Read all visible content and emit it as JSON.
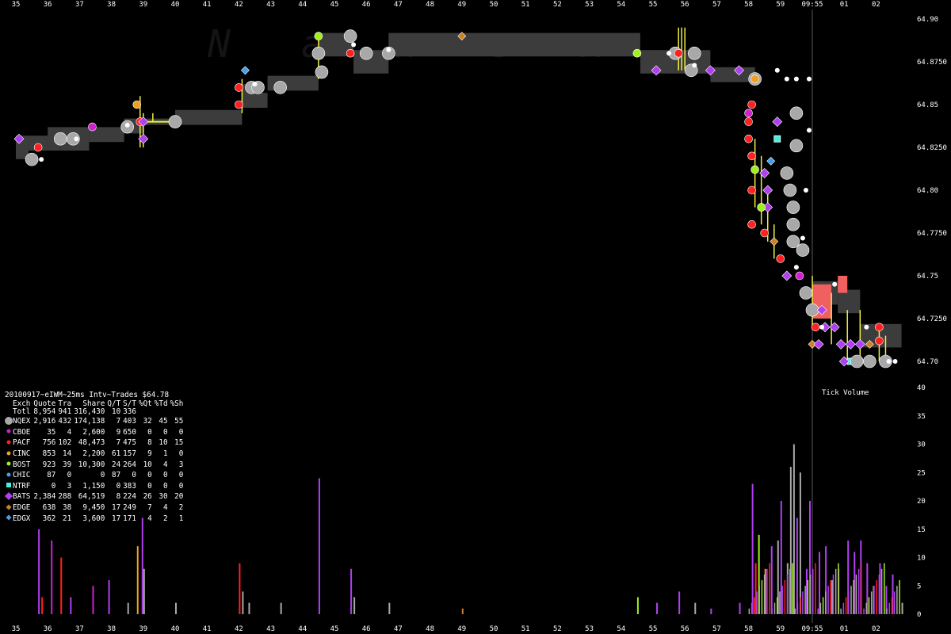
{
  "watermark": "Nanex",
  "legend": {
    "title": "20100917~eIWM~25ms Intv~Trades $64.78",
    "headers": [
      "Exch",
      "Quote",
      "Tra",
      "Share",
      "Q/T",
      "S/T",
      "%Qt",
      "%Td",
      "%Sh"
    ],
    "rows": [
      {
        "exch": "Totl",
        "quote": "8,954",
        "tra": "941",
        "share": "316,430",
        "qt": "10",
        "st": "336",
        "pq": "",
        "ptd": "",
        "psh": "",
        "color": "",
        "marker": "none"
      },
      {
        "exch": "NQEX",
        "quote": "2,916",
        "tra": "432",
        "share": "174,138",
        "qt": "7",
        "st": "403",
        "pq": "32",
        "ptd": "45",
        "psh": "55",
        "color": "#a8a8a8",
        "marker": "circle-large"
      },
      {
        "exch": "CBOE",
        "quote": "35",
        "tra": "4",
        "share": "2,600",
        "qt": "9",
        "st": "650",
        "pq": "0",
        "ptd": "0",
        "psh": "0",
        "color": "#d020d0",
        "marker": "circle"
      },
      {
        "exch": "PACF",
        "quote": "756",
        "tra": "102",
        "share": "48,473",
        "qt": "7",
        "st": "475",
        "pq": "8",
        "ptd": "10",
        "psh": "15",
        "color": "#ff2020",
        "marker": "circle"
      },
      {
        "exch": "CINC",
        "quote": "853",
        "tra": "14",
        "share": "2,200",
        "qt": "61",
        "st": "157",
        "pq": "9",
        "ptd": "1",
        "psh": "0",
        "color": "#f0a020",
        "marker": "circle"
      },
      {
        "exch": "BOST",
        "quote": "923",
        "tra": "39",
        "share": "10,300",
        "qt": "24",
        "st": "264",
        "pq": "10",
        "ptd": "4",
        "psh": "3",
        "color": "#a0f020",
        "marker": "circle"
      },
      {
        "exch": "CHIC",
        "quote": "87",
        "tra": "0",
        "share": "0",
        "qt": "87",
        "st": "0",
        "pq": "0",
        "ptd": "0",
        "psh": "0",
        "color": "#40a0f0",
        "marker": "circle"
      },
      {
        "exch": "NTRF",
        "quote": "0",
        "tra": "3",
        "share": "1,150",
        "qt": "0",
        "st": "383",
        "pq": "0",
        "ptd": "0",
        "psh": "0",
        "color": "#40f0e0",
        "marker": "square"
      },
      {
        "exch": "BATS",
        "quote": "2,384",
        "tra": "288",
        "share": "64,519",
        "qt": "8",
        "st": "224",
        "pq": "26",
        "ptd": "30",
        "psh": "20",
        "color": "#b040f0",
        "marker": "diamond-large"
      },
      {
        "exch": "EDGE",
        "quote": "638",
        "tra": "38",
        "share": "9,450",
        "qt": "17",
        "st": "249",
        "pq": "7",
        "ptd": "4",
        "psh": "2",
        "color": "#d08020",
        "marker": "diamond"
      },
      {
        "exch": "EDGX",
        "quote": "362",
        "tra": "21",
        "share": "3,600",
        "qt": "17",
        "st": "171",
        "pq": "4",
        "ptd": "2",
        "psh": "1",
        "color": "#40a0f0",
        "marker": "diamond"
      }
    ]
  },
  "chart_data": [
    {
      "type": "scatter",
      "title": "",
      "x_axis": {
        "ticks": [
          "35",
          "36",
          "37",
          "38",
          "39",
          "40",
          "41",
          "42",
          "43",
          "44",
          "45",
          "46",
          "47",
          "48",
          "49",
          "50",
          "51",
          "52",
          "53",
          "54",
          "55",
          "56",
          "57",
          "58",
          "59",
          "09:55",
          "01",
          "02"
        ],
        "highlight_label": "09:55"
      },
      "y_axis": {
        "side": "right",
        "ticks": [
          "64.90",
          "64.8750",
          "64.85",
          "64.8250",
          "64.80",
          "64.7750",
          "64.75",
          "64.7250",
          "64.70"
        ],
        "ylim": [
          64.7,
          64.9
        ]
      },
      "nbbo_bands": [
        {
          "x0": 35.0,
          "x1": 35.4,
          "bid": 64.82,
          "ask": 64.83
        },
        {
          "x0": 35.4,
          "x1": 36.0,
          "bid": 64.825,
          "ask": 64.83
        },
        {
          "x0": 36.0,
          "x1": 36.4,
          "bid": 64.825,
          "ask": 64.835
        },
        {
          "x0": 36.4,
          "x1": 37.3,
          "bid": 64.825,
          "ask": 64.835
        },
        {
          "x0": 37.3,
          "x1": 38.4,
          "bid": 64.83,
          "ask": 64.835
        },
        {
          "x0": 38.4,
          "x1": 39.0,
          "bid": 64.835,
          "ask": 64.84
        },
        {
          "x0": 39.0,
          "x1": 40.0,
          "bid": 64.84,
          "ask": 64.84
        },
        {
          "x0": 40.0,
          "x1": 42.1,
          "bid": 64.84,
          "ask": 64.845
        },
        {
          "x0": 42.1,
          "x1": 42.6,
          "bid": 64.85,
          "ask": 64.86
        },
        {
          "x0": 42.6,
          "x1": 42.9,
          "bid": 64.85,
          "ask": 64.855
        },
        {
          "x0": 42.9,
          "x1": 44.5,
          "bid": 64.86,
          "ask": 64.865
        },
        {
          "x0": 44.5,
          "x1": 45.6,
          "bid": 64.88,
          "ask": 64.89
        },
        {
          "x0": 45.6,
          "x1": 46.7,
          "bid": 64.87,
          "ask": 64.88
        },
        {
          "x0": 46.7,
          "x1": 54.6,
          "bid": 64.88,
          "ask": 64.89
        },
        {
          "x0": 54.6,
          "x1": 55.7,
          "bid": 64.87,
          "ask": 64.88
        },
        {
          "x0": 55.7,
          "x1": 56.8,
          "bid": 64.87,
          "ask": 64.88
        },
        {
          "x0": 56.8,
          "x1": 58.2,
          "bid": 64.865,
          "ask": 64.87
        },
        {
          "x0": 60.0,
          "x1": 60.4,
          "bid": 64.73,
          "ask": 64.745
        },
        {
          "x0": 60.4,
          "x1": 60.8,
          "bid": 64.735,
          "ask": 64.745
        },
        {
          "x0": 60.8,
          "x1": 61.5,
          "bid": 64.73,
          "ask": 64.74
        },
        {
          "x0": 61.5,
          "x1": 62.8,
          "bid": 64.71,
          "ask": 64.72
        }
      ],
      "trades": [
        {
          "t": 35.1,
          "p": 64.83,
          "exch": "BATS"
        },
        {
          "t": 35.7,
          "p": 64.825,
          "exch": "PACF"
        },
        {
          "t": 35.5,
          "p": 64.818,
          "exch": "NQEX"
        },
        {
          "t": 36.4,
          "p": 64.83,
          "exch": "NQEX"
        },
        {
          "t": 36.8,
          "p": 64.83,
          "exch": "NQEX"
        },
        {
          "t": 37.4,
          "p": 64.837,
          "exch": "CBOE"
        },
        {
          "t": 38.5,
          "p": 64.837,
          "exch": "NQEX"
        },
        {
          "t": 38.8,
          "p": 64.85,
          "exch": "CINC"
        },
        {
          "t": 38.9,
          "p": 64.84,
          "exch": "PACF"
        },
        {
          "t": 39.0,
          "p": 64.84,
          "exch": "BATS"
        },
        {
          "t": 39.0,
          "p": 64.83,
          "exch": "BATS"
        },
        {
          "t": 40.0,
          "p": 64.84,
          "exch": "NQEX"
        },
        {
          "t": 42.0,
          "p": 64.85,
          "exch": "PACF"
        },
        {
          "t": 42.0,
          "p": 64.86,
          "exch": "PACF"
        },
        {
          "t": 42.2,
          "p": 64.87,
          "exch": "EDGX"
        },
        {
          "t": 42.4,
          "p": 64.86,
          "exch": "NQEX"
        },
        {
          "t": 42.6,
          "p": 64.86,
          "exch": "NQEX"
        },
        {
          "t": 43.3,
          "p": 64.86,
          "exch": "NQEX"
        },
        {
          "t": 44.5,
          "p": 64.89,
          "exch": "BOST"
        },
        {
          "t": 44.5,
          "p": 64.88,
          "exch": "NQEX"
        },
        {
          "t": 44.6,
          "p": 64.869,
          "exch": "NQEX"
        },
        {
          "t": 45.5,
          "p": 64.89,
          "exch": "NQEX"
        },
        {
          "t": 45.5,
          "p": 64.88,
          "exch": "PACF"
        },
        {
          "t": 46.0,
          "p": 64.88,
          "exch": "NQEX"
        },
        {
          "t": 46.7,
          "p": 64.88,
          "exch": "NQEX"
        },
        {
          "t": 49.0,
          "p": 64.89,
          "exch": "EDGE"
        },
        {
          "t": 54.5,
          "p": 64.88,
          "exch": "BOST"
        },
        {
          "t": 55.1,
          "p": 64.87,
          "exch": "BATS"
        },
        {
          "t": 55.7,
          "p": 64.88,
          "exch": "NQEX"
        },
        {
          "t": 55.8,
          "p": 64.88,
          "exch": "PACF"
        },
        {
          "t": 56.2,
          "p": 64.87,
          "exch": "NQEX"
        },
        {
          "t": 56.3,
          "p": 64.88,
          "exch": "NQEX"
        },
        {
          "t": 56.8,
          "p": 64.87,
          "exch": "BATS"
        },
        {
          "t": 57.7,
          "p": 64.87,
          "exch": "BATS"
        },
        {
          "t": 58.2,
          "p": 64.865,
          "exch": "NQEX"
        },
        {
          "t": 58.2,
          "p": 64.865,
          "exch": "CINC"
        },
        {
          "t": 58.1,
          "p": 64.85,
          "exch": "PACF"
        },
        {
          "t": 58.0,
          "p": 64.845,
          "exch": "CBOE"
        },
        {
          "t": 58.0,
          "p": 64.84,
          "exch": "PACF"
        },
        {
          "t": 58.0,
          "p": 64.83,
          "exch": "PACF"
        },
        {
          "t": 58.1,
          "p": 64.82,
          "exch": "PACF"
        },
        {
          "t": 58.2,
          "p": 64.812,
          "exch": "BOST"
        },
        {
          "t": 58.5,
          "p": 64.81,
          "exch": "BATS"
        },
        {
          "t": 58.6,
          "p": 64.8,
          "exch": "BATS"
        },
        {
          "t": 58.1,
          "p": 64.8,
          "exch": "PACF"
        },
        {
          "t": 58.4,
          "p": 64.79,
          "exch": "BOST"
        },
        {
          "t": 58.6,
          "p": 64.79,
          "exch": "BATS"
        },
        {
          "t": 58.1,
          "p": 64.78,
          "exch": "PACF"
        },
        {
          "t": 58.5,
          "p": 64.775,
          "exch": "PACF"
        },
        {
          "t": 58.8,
          "p": 64.77,
          "exch": "EDGE"
        },
        {
          "t": 58.4,
          "p": 64.79,
          "exch": "BOST"
        },
        {
          "t": 58.9,
          "p": 64.84,
          "exch": "BATS"
        },
        {
          "t": 58.9,
          "p": 64.83,
          "exch": "NTRF"
        },
        {
          "t": 58.7,
          "p": 64.817,
          "exch": "EDGX"
        },
        {
          "t": 59.2,
          "p": 64.81,
          "exch": "NQEX"
        },
        {
          "t": 59.3,
          "p": 64.8,
          "exch": "NQEX"
        },
        {
          "t": 59.4,
          "p": 64.79,
          "exch": "NQEX"
        },
        {
          "t": 59.4,
          "p": 64.78,
          "exch": "NQEX"
        },
        {
          "t": 59.4,
          "p": 64.77,
          "exch": "NQEX"
        },
        {
          "t": 59.7,
          "p": 64.765,
          "exch": "NQEX"
        },
        {
          "t": 59.5,
          "p": 64.845,
          "exch": "NQEX"
        },
        {
          "t": 59.5,
          "p": 64.826,
          "exch": "NQEX"
        },
        {
          "t": 59.0,
          "p": 64.76,
          "exch": "PACF"
        },
        {
          "t": 59.2,
          "p": 64.75,
          "exch": "BATS"
        },
        {
          "t": 59.6,
          "p": 64.75,
          "exch": "CBOE"
        },
        {
          "t": 59.8,
          "p": 64.74,
          "exch": "NQEX"
        },
        {
          "t": 60.0,
          "p": 64.73,
          "exch": "NQEX"
        },
        {
          "t": 60.3,
          "p": 64.73,
          "exch": "BATS"
        },
        {
          "t": 60.1,
          "p": 64.72,
          "exch": "PACF"
        },
        {
          "t": 60.4,
          "p": 64.72,
          "exch": "BATS"
        },
        {
          "t": 60.7,
          "p": 64.72,
          "exch": "BATS"
        },
        {
          "t": 60.0,
          "p": 64.71,
          "exch": "EDGE"
        },
        {
          "t": 60.2,
          "p": 64.71,
          "exch": "BATS"
        },
        {
          "t": 60.9,
          "p": 64.71,
          "exch": "BATS"
        },
        {
          "t": 61.2,
          "p": 64.71,
          "exch": "BATS"
        },
        {
          "t": 61.5,
          "p": 64.71,
          "exch": "BATS"
        },
        {
          "t": 61.8,
          "p": 64.71,
          "exch": "EDGE"
        },
        {
          "t": 62.1,
          "p": 64.712,
          "exch": "PACF"
        },
        {
          "t": 61.2,
          "p": 64.7,
          "exch": "NTRF"
        },
        {
          "t": 61.0,
          "p": 64.7,
          "exch": "BATS"
        },
        {
          "t": 61.4,
          "p": 64.7,
          "exch": "NQEX"
        },
        {
          "t": 61.8,
          "p": 64.7,
          "exch": "NQEX"
        },
        {
          "t": 62.3,
          "p": 64.7,
          "exch": "NQEX"
        },
        {
          "t": 62.1,
          "p": 64.72,
          "exch": "PACF"
        }
      ]
    },
    {
      "type": "bar",
      "title": "Tick Volume",
      "y_axis": {
        "side": "right",
        "ticks": [
          "40",
          "35",
          "30",
          "25",
          "20",
          "15",
          "10",
          "5",
          "0"
        ],
        "ylim": [
          0,
          40
        ]
      },
      "bars": [
        {
          "t": 35.7,
          "v": 15,
          "exch": "BATS"
        },
        {
          "t": 35.8,
          "v": 3,
          "exch": "PACF"
        },
        {
          "t": 36.1,
          "v": 13,
          "exch": "CBOE"
        },
        {
          "t": 36.4,
          "v": 10,
          "exch": "PACF"
        },
        {
          "t": 36.7,
          "v": 3,
          "exch": "BATS"
        },
        {
          "t": 37.4,
          "v": 5,
          "exch": "CBOE"
        },
        {
          "t": 37.9,
          "v": 6,
          "exch": "BATS"
        },
        {
          "t": 38.5,
          "v": 2,
          "exch": "NQEX"
        },
        {
          "t": 38.8,
          "v": 12,
          "exch": "CINC"
        },
        {
          "t": 38.95,
          "v": 17,
          "exch": "BATS"
        },
        {
          "t": 39.0,
          "v": 8,
          "exch": "NQEX"
        },
        {
          "t": 40.0,
          "v": 2,
          "exch": "NQEX"
        },
        {
          "t": 42.0,
          "v": 9,
          "exch": "PACF"
        },
        {
          "t": 42.1,
          "v": 4,
          "exch": "NQEX"
        },
        {
          "t": 42.3,
          "v": 2,
          "exch": "NQEX"
        },
        {
          "t": 43.3,
          "v": 2,
          "exch": "NQEX"
        },
        {
          "t": 44.5,
          "v": 24,
          "exch": "BATS"
        },
        {
          "t": 45.5,
          "v": 8,
          "exch": "BATS"
        },
        {
          "t": 45.6,
          "v": 3,
          "exch": "NQEX"
        },
        {
          "t": 46.7,
          "v": 2,
          "exch": "NQEX"
        },
        {
          "t": 49.0,
          "v": 1,
          "exch": "EDGE"
        },
        {
          "t": 54.5,
          "v": 3,
          "exch": "BOST"
        },
        {
          "t": 55.1,
          "v": 2,
          "exch": "BATS"
        },
        {
          "t": 55.8,
          "v": 4,
          "exch": "BATS"
        },
        {
          "t": 56.3,
          "v": 2,
          "exch": "NQEX"
        },
        {
          "t": 56.8,
          "v": 1,
          "exch": "BATS"
        },
        {
          "t": 57.7,
          "v": 2,
          "exch": "BATS"
        },
        {
          "t": 58.1,
          "v": 23,
          "exch": "BATS"
        },
        {
          "t": 58.2,
          "v": 9,
          "exch": "PACF"
        },
        {
          "t": 58.3,
          "v": 14,
          "exch": "BOST"
        },
        {
          "t": 58.5,
          "v": 8,
          "exch": "CINC"
        },
        {
          "t": 58.7,
          "v": 12,
          "exch": "BATS"
        },
        {
          "t": 58.9,
          "v": 13,
          "exch": "NQEX"
        },
        {
          "t": 59.0,
          "v": 20,
          "exch": "BATS"
        },
        {
          "t": 59.2,
          "v": 9,
          "exch": "NQEX"
        },
        {
          "t": 59.3,
          "v": 26,
          "exch": "NQEX"
        },
        {
          "t": 59.4,
          "v": 30,
          "exch": "NQEX"
        },
        {
          "t": 59.5,
          "v": 17,
          "exch": "BATS"
        },
        {
          "t": 59.6,
          "v": 25,
          "exch": "NQEX"
        },
        {
          "t": 59.8,
          "v": 8,
          "exch": "BATS"
        },
        {
          "t": 59.9,
          "v": 20,
          "exch": "BATS"
        },
        {
          "t": 60.2,
          "v": 11,
          "exch": "BATS"
        },
        {
          "t": 60.4,
          "v": 12,
          "exch": "BATS"
        },
        {
          "t": 60.6,
          "v": 6,
          "exch": "NQEX"
        },
        {
          "t": 60.8,
          "v": 8,
          "exch": "BATS"
        },
        {
          "t": 61.1,
          "v": 13,
          "exch": "BATS"
        },
        {
          "t": 61.3,
          "v": 11,
          "exch": "BATS"
        },
        {
          "t": 61.5,
          "v": 13,
          "exch": "BATS"
        },
        {
          "t": 61.7,
          "v": 9,
          "exch": "BATS"
        },
        {
          "t": 61.9,
          "v": 5,
          "exch": "NQEX"
        },
        {
          "t": 62.1,
          "v": 9,
          "exch": "BATS"
        },
        {
          "t": 62.3,
          "v": 5,
          "exch": "BATS"
        },
        {
          "t": 62.5,
          "v": 7,
          "exch": "BATS"
        },
        {
          "t": 62.8,
          "v": 2,
          "exch": "NQEX"
        }
      ]
    }
  ]
}
